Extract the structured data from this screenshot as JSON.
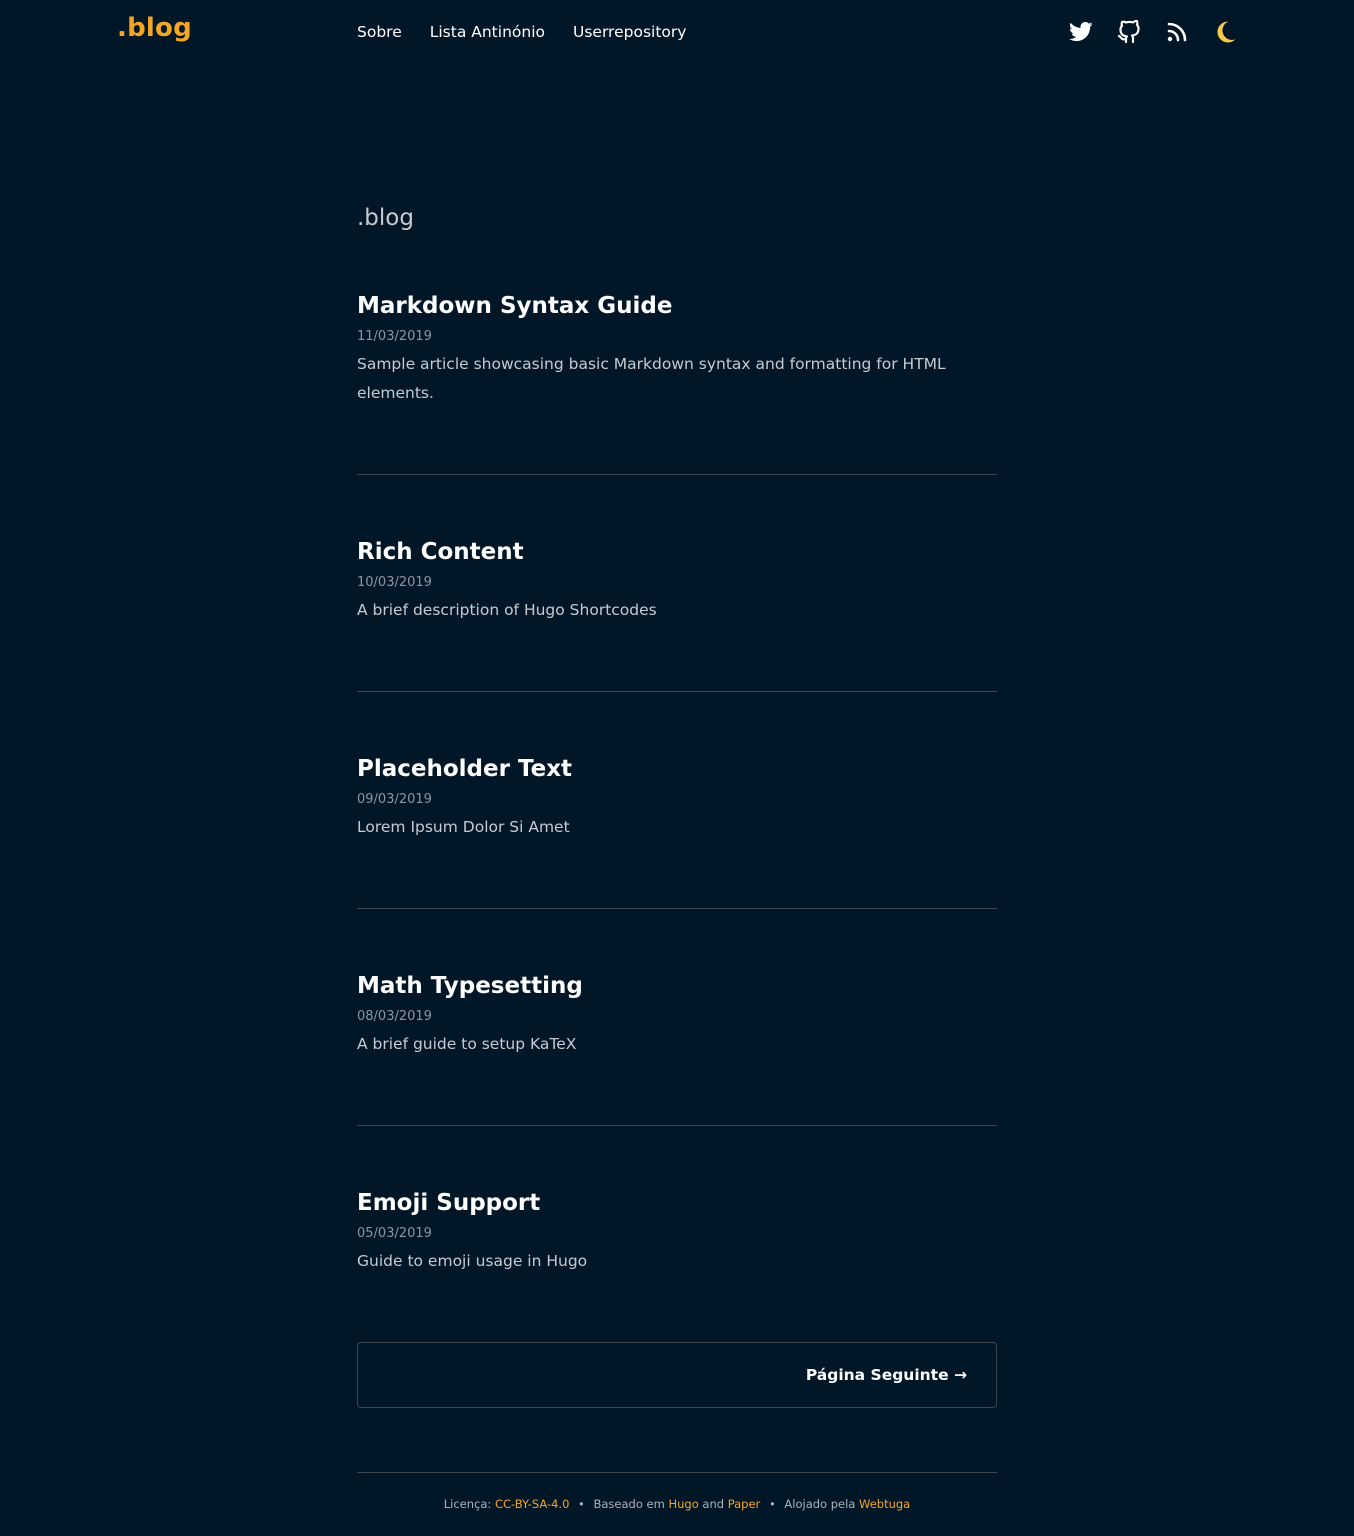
{
  "header": {
    "logo": ".blog",
    "nav": [
      "Sobre",
      "Lista Antinónio",
      "Userrepository"
    ],
    "icons": [
      "twitter-icon",
      "github-icon",
      "rss-icon",
      "moon-icon"
    ]
  },
  "page": {
    "heading": ".blog"
  },
  "posts": [
    {
      "title": "Markdown Syntax Guide",
      "date": "11/03/2019",
      "description": "Sample article showcasing basic Markdown syntax and formatting for HTML elements."
    },
    {
      "title": "Rich Content",
      "date": "10/03/2019",
      "description": "A brief description of Hugo Shortcodes"
    },
    {
      "title": "Placeholder Text",
      "date": "09/03/2019",
      "description": "Lorem Ipsum Dolor Si Amet"
    },
    {
      "title": "Math Typesetting",
      "date": "08/03/2019",
      "description": "A brief guide to setup KaTeX"
    },
    {
      "title": "Emoji Support",
      "date": "05/03/2019",
      "description": "Guide to emoji usage in Hugo"
    }
  ],
  "pagination": {
    "next_label": "Página Seguinte →"
  },
  "footer": {
    "license_label": "Licença:",
    "license_link": "CC-BY-SA-4.0",
    "separator": "•",
    "based_label": "Baseado em",
    "hugo_link": "Hugo",
    "and_label": "and",
    "paper_link": "Paper",
    "hosted_label": "Alojado pela",
    "webtuga_link": "Webtuga"
  },
  "colors": {
    "background": "#011627",
    "accent": "#f5a623",
    "moon": "#f7c948"
  }
}
